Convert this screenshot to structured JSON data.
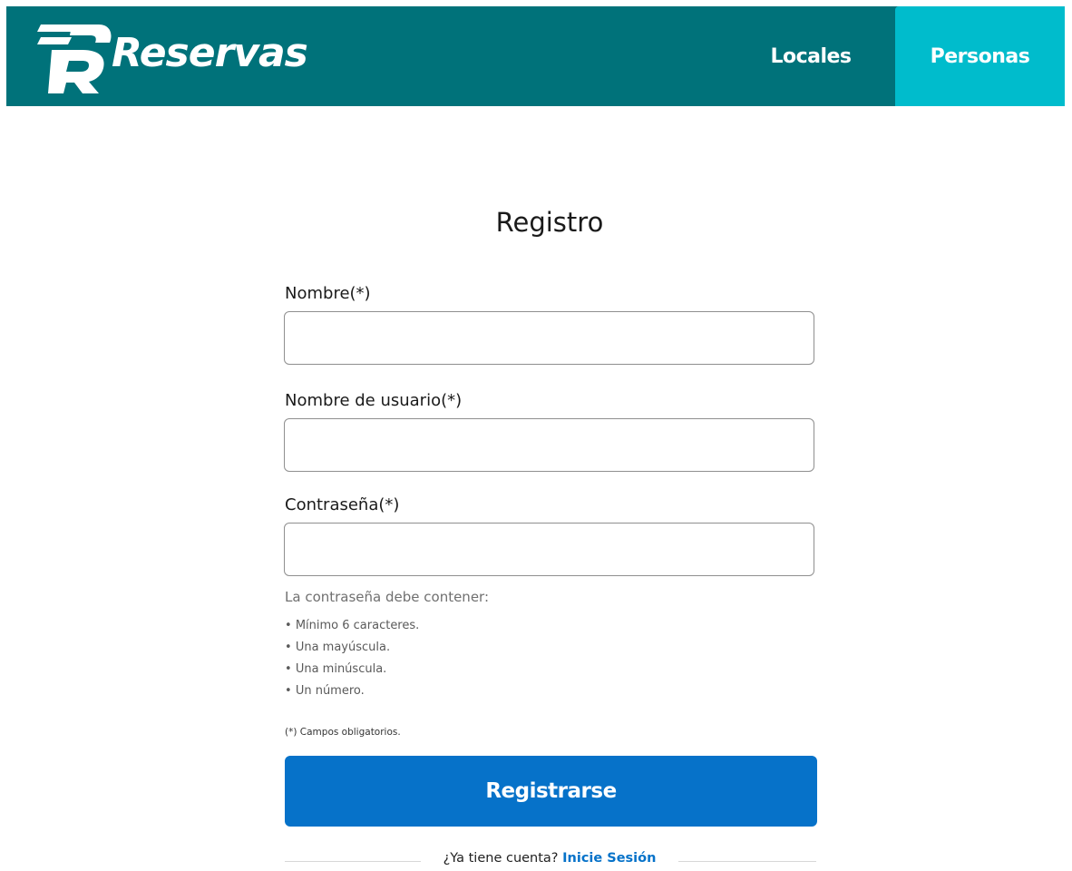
{
  "header": {
    "brand": "Reservas",
    "nav": [
      {
        "label": "Locales"
      },
      {
        "label": "Personas"
      }
    ],
    "colors": {
      "bar": "#00727a",
      "active_tab": "#00bccc"
    }
  },
  "form": {
    "title": "Registro",
    "fields": {
      "name": {
        "label": "Nombre(*)",
        "value": "",
        "placeholder": ""
      },
      "username": {
        "label": "Nombre de usuario(*)",
        "value": "",
        "placeholder": ""
      },
      "password": {
        "label": "Contraseña(*)",
        "value": "",
        "placeholder": ""
      }
    },
    "password_hint": {
      "title": "La contraseña debe contener:",
      "rules": [
        "Mínimo 6 caracteres.",
        "Una mayúscula.",
        "Una minúscula.",
        "Un número."
      ]
    },
    "required_note": "(*) Campos obligatorios.",
    "submit_label": "Registrarse",
    "submit_color": "#0672c9"
  },
  "footer": {
    "prompt": "¿Ya tiene cuenta?",
    "link_label": "Inicie Sesión"
  }
}
